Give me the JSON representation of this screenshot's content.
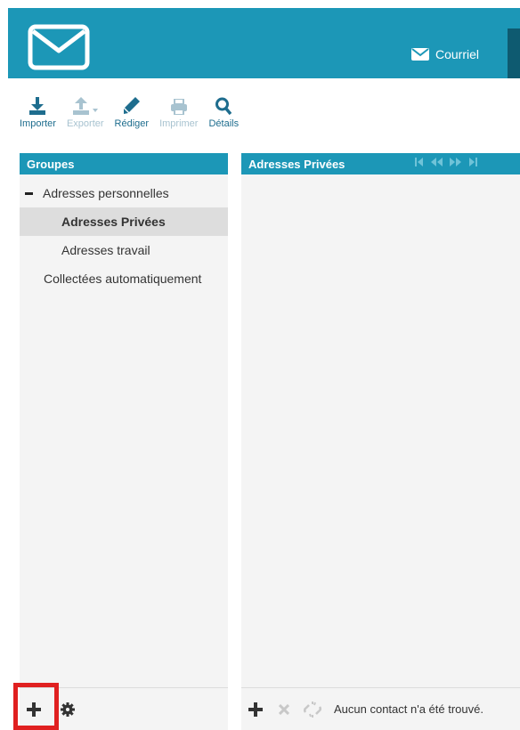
{
  "header": {
    "mail_label": "Courriel"
  },
  "toolbar": {
    "import_label": "Importer",
    "export_label": "Exporter",
    "compose_label": "Rédiger",
    "print_label": "Imprimer",
    "details_label": "Détails"
  },
  "groups": {
    "title": "Groupes",
    "addressbook": "Adresses personnelles",
    "items": [
      "Adresses Privées",
      "Adresses travail"
    ],
    "collected": "Collectées automatiquement"
  },
  "contacts": {
    "title": "Adresses Privées",
    "status": "Aucun contact n'a été trouvé."
  },
  "colors": {
    "header": "#1c97b7",
    "link": "#1e6d8e",
    "panel_bg": "#f4f4f4",
    "selected_bg": "#dddddd",
    "highlight": "#e02020"
  }
}
